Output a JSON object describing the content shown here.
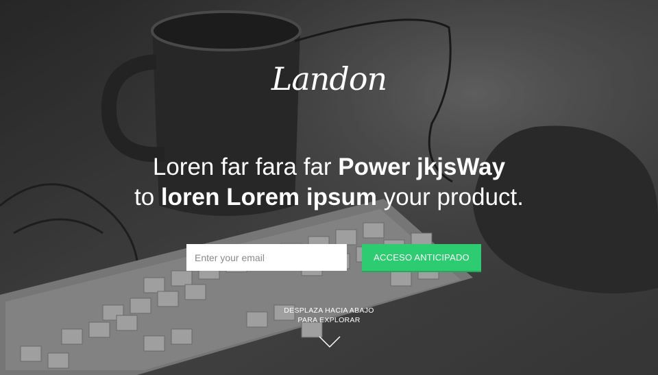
{
  "brand": {
    "logo_text": "Landon"
  },
  "hero": {
    "headline": {
      "line1_prefix": "Loren far fara far ",
      "line1_bold": "Power jkjsWay",
      "line2_prefix": "to ",
      "line2_bold": "loren Lorem ipsum",
      "line2_suffix": " your product."
    },
    "signup": {
      "email_placeholder": "Enter your email",
      "email_value": "",
      "cta_label": "ACCESO ANTICIPADO"
    },
    "scroll_hint": {
      "line1": "DESPLAZA HACIA ABAJO",
      "line2": "PARA EXPLORAR",
      "icon": "chevron-down-icon"
    }
  },
  "colors": {
    "accent": "#2ecc71",
    "text": "#ffffff"
  }
}
